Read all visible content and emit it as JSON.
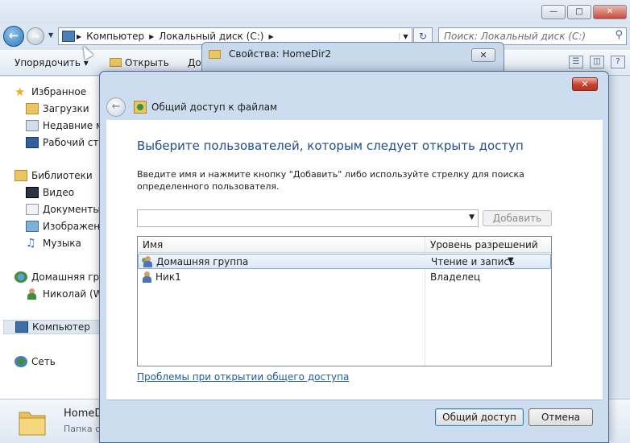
{
  "explorer": {
    "address": {
      "crumbs": [
        "Компьютер",
        "Локальный диск (C:)"
      ]
    },
    "search_placeholder": "Поиск: Локальный диск (C:)",
    "toolbar": {
      "organize": "Упорядочить ▾",
      "open": "Открыть",
      "share_partial": "До"
    },
    "nav": {
      "favorites": "Избранное",
      "downloads": "Загрузки",
      "recent": "Недавние ме",
      "desktop": "Рабочий сто",
      "libraries": "Библиотеки",
      "video": "Видео",
      "documents": "Документы",
      "images": "Изображения",
      "music": "Музыка",
      "homegroup": "Домашняя гру",
      "nikolai": "Николай (WI",
      "computer": "Компьютер",
      "network": "Сеть"
    },
    "details": {
      "name": "HomeD",
      "type": "Папка с"
    }
  },
  "props_window": {
    "title": "Свойства: HomeDir2"
  },
  "dialog": {
    "title": "Общий доступ к файлам",
    "heading": "Выберите пользователей, которым следует открыть доступ",
    "instruction": "Введите имя и нажмите кнопку \"Добавить\" либо используйте стрелку для поиска определенного пользователя.",
    "combo_value": "",
    "add_button": "Добавить",
    "columns": {
      "name": "Имя",
      "permission": "Уровень разрешений"
    },
    "rows": [
      {
        "name": "Домашняя группа",
        "permission": "Чтение и запись",
        "selected": true
      },
      {
        "name": "Ник1",
        "permission": "Владелец",
        "selected": false
      }
    ],
    "help_link": "Проблемы при открытии общего доступа",
    "share_button": "Общий доступ",
    "cancel_button": "Отмена"
  }
}
